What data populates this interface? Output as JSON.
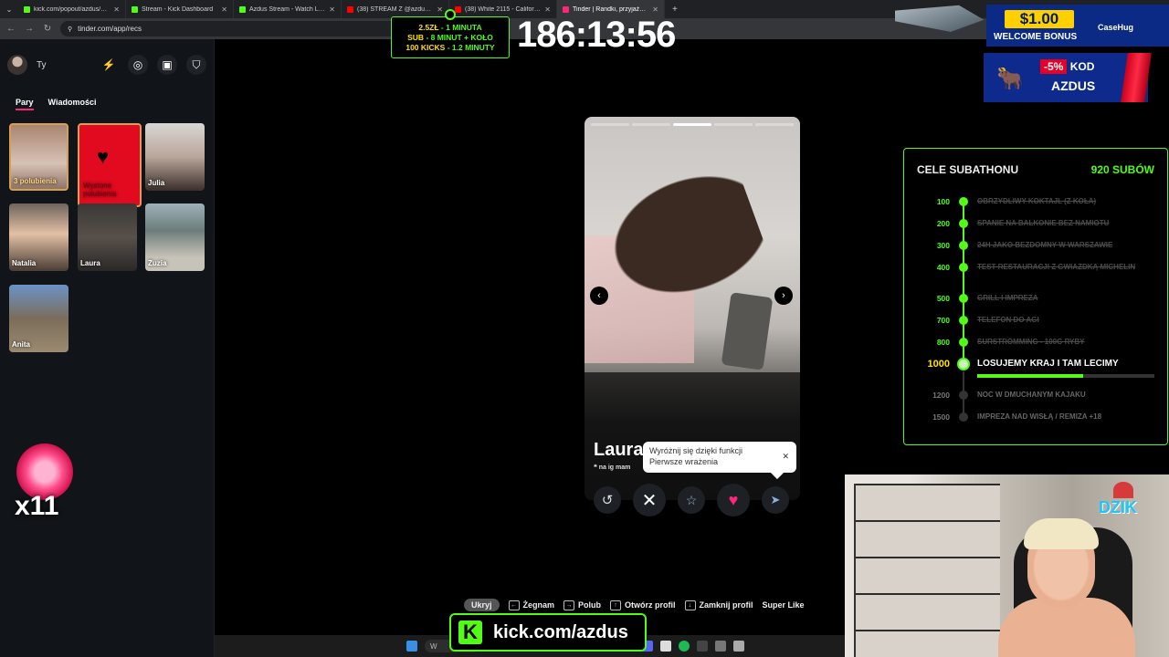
{
  "browser": {
    "tabs": [
      {
        "title": "kick.com/popout/azdus/chat",
        "color": "#53fc18"
      },
      {
        "title": "Stream - Kick Dashboard",
        "color": "#53fc18"
      },
      {
        "title": "Azdus Stream - Watch Live on Kick",
        "color": "#53fc18"
      },
      {
        "title": "(38) STREAM Z @azdus GRAMY",
        "color": "#ff0000"
      },
      {
        "title": "(38) White 2115 - California aloha",
        "color": "#ff0000"
      },
      {
        "title": "Tinder | Randki, przyjaźń, nowe",
        "color": "#fd267a"
      }
    ],
    "url": "tinder.com/app/recs"
  },
  "sidebar": {
    "profile_label": "Ty",
    "tabs": [
      "Pary",
      "Wiadomości"
    ],
    "tiles": [
      {
        "label": "3 polubienia",
        "type": "likes"
      },
      {
        "label": "Wystone polubienia",
        "type": "boost"
      },
      {
        "label": "Julia",
        "type": "person",
        "bg": "linear-gradient(180deg,#d9d6d3,#b9a69b 50%,#3b2f2a)"
      },
      {
        "label": "Natalia",
        "type": "person",
        "bg": "linear-gradient(180deg,#6f645c,#e2c0a5 45%,#4b3d35)"
      },
      {
        "label": "Laura",
        "type": "person",
        "bg": "linear-gradient(180deg,#3a3836,#58504a 50%,#2a2826)"
      },
      {
        "label": "Zuzia",
        "type": "person",
        "bg": "linear-gradient(180deg,#9fb1b8,#6c7d7b 40%,#c8c3b8 80%)"
      },
      {
        "label": "Anita",
        "type": "person",
        "bg": "linear-gradient(180deg,#6b93c4,#7b6d5b 50%,#9c8a70)"
      }
    ]
  },
  "card": {
    "name": "Laura",
    "bio": "na ig mam",
    "tooltip_line1": "Wyróżnij się dzięki funkcji",
    "tooltip_line2": "Pierwsze wrażenia",
    "photo_count": 5,
    "photo_active": 3
  },
  "hotkeys": [
    {
      "key": "",
      "label": "Ukryj"
    },
    {
      "key": "←",
      "label": "Żegnam"
    },
    {
      "key": "→",
      "label": "Polub"
    },
    {
      "key": "↑",
      "label": "Otwórz profil"
    },
    {
      "key": "↓",
      "label": "Zamknij profil"
    },
    {
      "key": "",
      "label": "Super Like"
    }
  ],
  "overlay": {
    "rate1_a": "2.5ZŁ",
    "rate1_b": " - 1 MINUTA",
    "rate2_a": "SUB",
    "rate2_b": " - 8 MINUT + KOŁO",
    "rate3_a": "100 KICKS",
    "rate3_b": " - 1.2 MINUTY",
    "timer": "186:13:56",
    "bonus_amount": "$1.00",
    "bonus_text": "WELCOME BONUS",
    "bonus_brand": "CaseHug",
    "promo_discount": "-5%",
    "promo_kod": "KOD",
    "promo_code": "AZDUS",
    "kick_url": "kick.com/azdus",
    "boost_mult": "x11",
    "webcam_logo": "DZIK"
  },
  "subathon": {
    "title": "CELE SUBATHONU",
    "count": "920 SUBÓW",
    "current_progress": 0.6,
    "goals": [
      {
        "amount": "100",
        "label": "OBRZYDLIWY KOKTAJL (Z KOŁA)",
        "state": "done"
      },
      {
        "amount": "200",
        "label": "SPANIE NA BALKONIE BEZ NAMIOTU",
        "state": "done"
      },
      {
        "amount": "300",
        "label": "24H JAKO BEZDOMNY W WARSZAWIE",
        "state": "done"
      },
      {
        "amount": "400",
        "label": "TEST RESTAURACJI Z GWIAZDKĄ MICHELIN",
        "state": "done"
      },
      {
        "amount": "500",
        "label": "GRILL I IMPREZA",
        "state": "done"
      },
      {
        "amount": "700",
        "label": "TELEFON DO AGI",
        "state": "done"
      },
      {
        "amount": "800",
        "label": "SURSTRÖMMING - 100G RYBY",
        "state": "done"
      },
      {
        "amount": "1000",
        "label": "LOSUJEMY KRAJ I TAM LECIMY",
        "state": "current"
      },
      {
        "amount": "1200",
        "label": "NOC W DMUCHANYM KAJAKU",
        "state": "future"
      },
      {
        "amount": "1500",
        "label": "IMPREZA NAD WISŁĄ / REMIZA +18",
        "state": "future"
      }
    ]
  },
  "taskbar": {
    "search_placeholder": "W"
  }
}
